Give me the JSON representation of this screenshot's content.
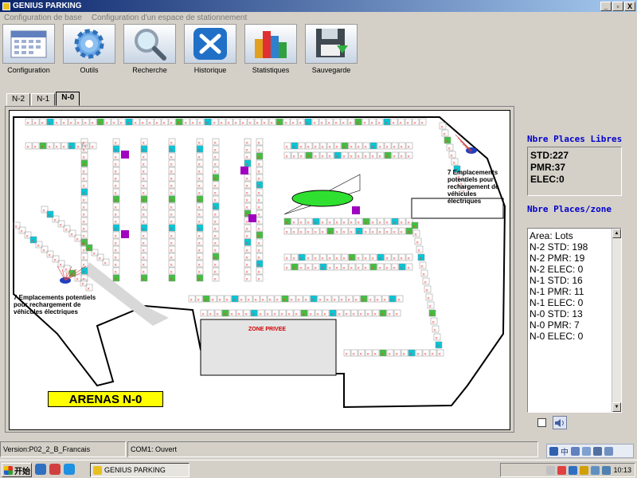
{
  "window": {
    "title": "GENIUS PARKING",
    "min": "_",
    "max": "▫",
    "close": "X"
  },
  "menu": [
    "Configuration de base",
    "Configuration d'un espace de stationnement"
  ],
  "toolbar": [
    {
      "label": "Configuration",
      "icon": "calendar-icon"
    },
    {
      "label": "Outils",
      "icon": "gear-icon"
    },
    {
      "label": "Recherche",
      "icon": "magnifier-icon"
    },
    {
      "label": "Historique",
      "icon": "tools-icon"
    },
    {
      "label": "Statistiques",
      "icon": "bar-chart-icon"
    },
    {
      "label": "Sauvegarde",
      "icon": "floppy-disk-icon"
    }
  ],
  "tabs": [
    "N-2",
    "N-1",
    "N-0"
  ],
  "map": {
    "title": "ARENAS  N-0",
    "annotation_left": "7 Emplacements potentiels pour rechargement de véhicules électriques",
    "annotation_right": "7 Emplacements potentiels pour rechargement de véhicules électriques",
    "zone_privee": "ZONE PRIVEE",
    "colors": {
      "spot": "#f04040",
      "pmr": "#00c8d8",
      "elec": "#40c040",
      "busy": "#a000c0",
      "fill_green": "#30e030"
    }
  },
  "libres": {
    "title": "Nbre Places Libres",
    "lines": [
      "STD:227",
      "PMR:37",
      "ELEC:0"
    ]
  },
  "zones": {
    "title": "Nbre Places/zone",
    "items": [
      "Area: Lots",
      "N-2 STD: 198",
      "N-2 PMR: 19",
      "N-2 ELEC: 0",
      "N-1 STD: 16",
      "N-1 PMR: 11",
      "N-1 ELEC: 0",
      "N-0 STD: 13",
      "N-0 PMR: 7",
      "N-0 ELEC: 0"
    ]
  },
  "status": {
    "version": "Version:P02_2_B_Francais",
    "com": "COM1:  Ouvert"
  },
  "taskbar": {
    "start": "开始",
    "app": "GENIUS PARKING",
    "clock": "10:13",
    "ime": "中"
  }
}
